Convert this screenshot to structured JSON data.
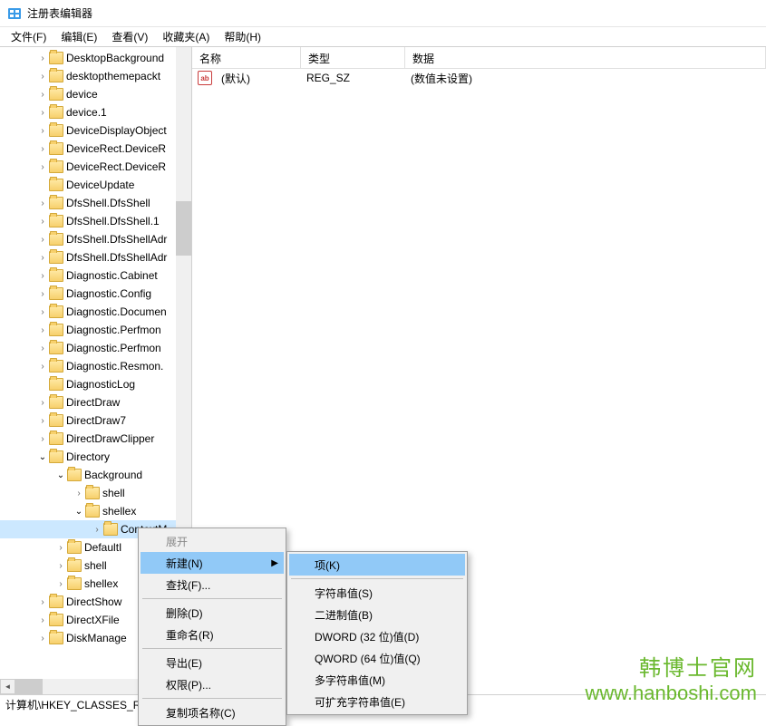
{
  "window": {
    "title": "注册表编辑器"
  },
  "menubar": {
    "file": "文件(F)",
    "edit": "编辑(E)",
    "view": "查看(V)",
    "favorites": "收藏夹(A)",
    "help": "帮助(H)"
  },
  "tree": {
    "items": [
      {
        "indent": 40,
        "chev": ">",
        "label": "DesktopBackground"
      },
      {
        "indent": 40,
        "chev": ">",
        "label": "desktopthemepackt"
      },
      {
        "indent": 40,
        "chev": ">",
        "label": "device"
      },
      {
        "indent": 40,
        "chev": ">",
        "label": "device.1"
      },
      {
        "indent": 40,
        "chev": ">",
        "label": "DeviceDisplayObject"
      },
      {
        "indent": 40,
        "chev": ">",
        "label": "DeviceRect.DeviceR"
      },
      {
        "indent": 40,
        "chev": ">",
        "label": "DeviceRect.DeviceR"
      },
      {
        "indent": 40,
        "chev": "",
        "label": "DeviceUpdate"
      },
      {
        "indent": 40,
        "chev": ">",
        "label": "DfsShell.DfsShell"
      },
      {
        "indent": 40,
        "chev": ">",
        "label": "DfsShell.DfsShell.1"
      },
      {
        "indent": 40,
        "chev": ">",
        "label": "DfsShell.DfsShellAdr"
      },
      {
        "indent": 40,
        "chev": ">",
        "label": "DfsShell.DfsShellAdr"
      },
      {
        "indent": 40,
        "chev": ">",
        "label": "Diagnostic.Cabinet"
      },
      {
        "indent": 40,
        "chev": ">",
        "label": "Diagnostic.Config"
      },
      {
        "indent": 40,
        "chev": ">",
        "label": "Diagnostic.Documen"
      },
      {
        "indent": 40,
        "chev": ">",
        "label": "Diagnostic.Perfmon"
      },
      {
        "indent": 40,
        "chev": ">",
        "label": "Diagnostic.Perfmon"
      },
      {
        "indent": 40,
        "chev": ">",
        "label": "Diagnostic.Resmon."
      },
      {
        "indent": 40,
        "chev": "",
        "label": "DiagnosticLog"
      },
      {
        "indent": 40,
        "chev": ">",
        "label": "DirectDraw"
      },
      {
        "indent": 40,
        "chev": ">",
        "label": "DirectDraw7"
      },
      {
        "indent": 40,
        "chev": ">",
        "label": "DirectDrawClipper"
      },
      {
        "indent": 40,
        "chev": "v",
        "label": "Directory"
      },
      {
        "indent": 60,
        "chev": "v",
        "label": "Background"
      },
      {
        "indent": 80,
        "chev": ">",
        "label": "shell"
      },
      {
        "indent": 80,
        "chev": "v",
        "label": "shellex"
      },
      {
        "indent": 100,
        "chev": ">",
        "label": "ContextM",
        "selected": true
      },
      {
        "indent": 60,
        "chev": ">",
        "label": "DefaultI"
      },
      {
        "indent": 60,
        "chev": ">",
        "label": "shell"
      },
      {
        "indent": 60,
        "chev": ">",
        "label": "shellex"
      },
      {
        "indent": 40,
        "chev": ">",
        "label": "DirectShow"
      },
      {
        "indent": 40,
        "chev": ">",
        "label": "DirectXFile"
      },
      {
        "indent": 40,
        "chev": ">",
        "label": "DiskManage"
      }
    ]
  },
  "list": {
    "columns": {
      "name": "名称",
      "type": "类型",
      "data": "数据"
    },
    "rows": [
      {
        "name": "(默认)",
        "type": "REG_SZ",
        "data": "(数值未设置)"
      }
    ]
  },
  "context_menu_1": {
    "expand": "展开",
    "new": "新建(N)",
    "find": "查找(F)...",
    "delete": "删除(D)",
    "rename": "重命名(R)",
    "export": "导出(E)",
    "permissions": "权限(P)...",
    "copy_key_name": "复制项名称(C)"
  },
  "context_menu_2": {
    "key": "项(K)",
    "string": "字符串值(S)",
    "binary": "二进制值(B)",
    "dword": "DWORD (32 位)值(D)",
    "qword": "QWORD (64 位)值(Q)",
    "multi_string": "多字符串值(M)",
    "expand_string": "可扩充字符串值(E)"
  },
  "statusbar": {
    "path": "计算机\\HKEY_CLASSES_RO"
  },
  "watermark": {
    "line1": "韩博士官网",
    "line2": "www.hanboshi.com"
  }
}
